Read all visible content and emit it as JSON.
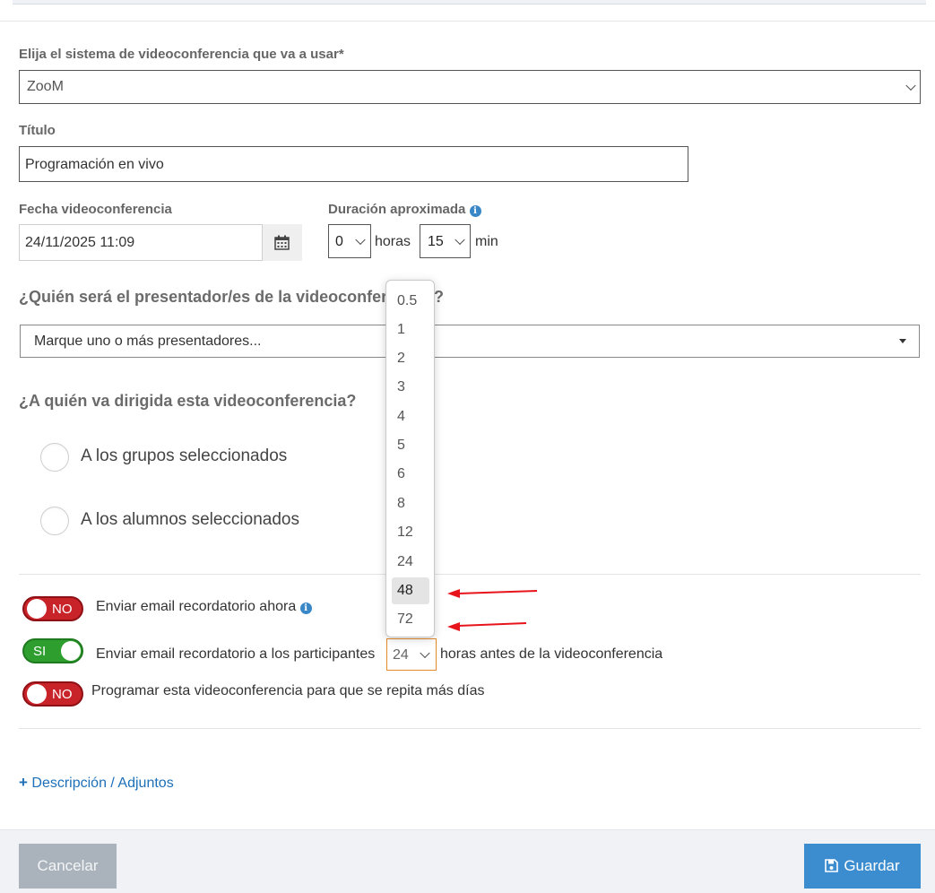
{
  "form": {
    "system_label": "Elija el sistema de videoconferencia que va a usar*",
    "system_value": "ZooM",
    "title_label": "Título",
    "title_value": "Programación en vivo",
    "date_label": "Fecha videoconferencia",
    "date_value": "24/11/2025 11:09",
    "duration_label": "Duración aproximada",
    "duration_hours_value": "0",
    "duration_hours_unit": "horas",
    "duration_min_value": "15",
    "duration_min_unit": "min",
    "presenter_question": "¿Quién será el presentador/es de la videoconfer",
    "presenter_question_end": "?",
    "presenter_placeholder": "Marque uno o más presentadores...",
    "audience_question": "¿A quién va dirigida esta videoconferencia?",
    "audience_options": [
      "A los grupos seleccionados",
      "A los alumnos seleccionados"
    ]
  },
  "toggles": {
    "reminder_now": {
      "state": "NO",
      "label": "Enviar email recordatorio ahora"
    },
    "reminder_before": {
      "state": "SI",
      "label": "Enviar email recordatorio a los participantes",
      "hours_value": "24",
      "suffix": "horas antes de la videoconferencia"
    },
    "repeat": {
      "state": "NO",
      "label": "Programar esta videoconferencia para que se repita más días"
    }
  },
  "hours_dropdown": {
    "options": [
      "0.5",
      "1",
      "2",
      "3",
      "4",
      "5",
      "6",
      "8",
      "12",
      "24",
      "48",
      "72"
    ],
    "highlighted": "48"
  },
  "links": {
    "description": "Descripción / Adjuntos"
  },
  "footer": {
    "cancel_label": "Cancelar",
    "save_label": "Guardar"
  },
  "colors": {
    "accent": "#3c8dcf",
    "toggle_off": "#c9232a",
    "toggle_on": "#2e9e2e",
    "annotation_arrow": "#e8141b"
  }
}
